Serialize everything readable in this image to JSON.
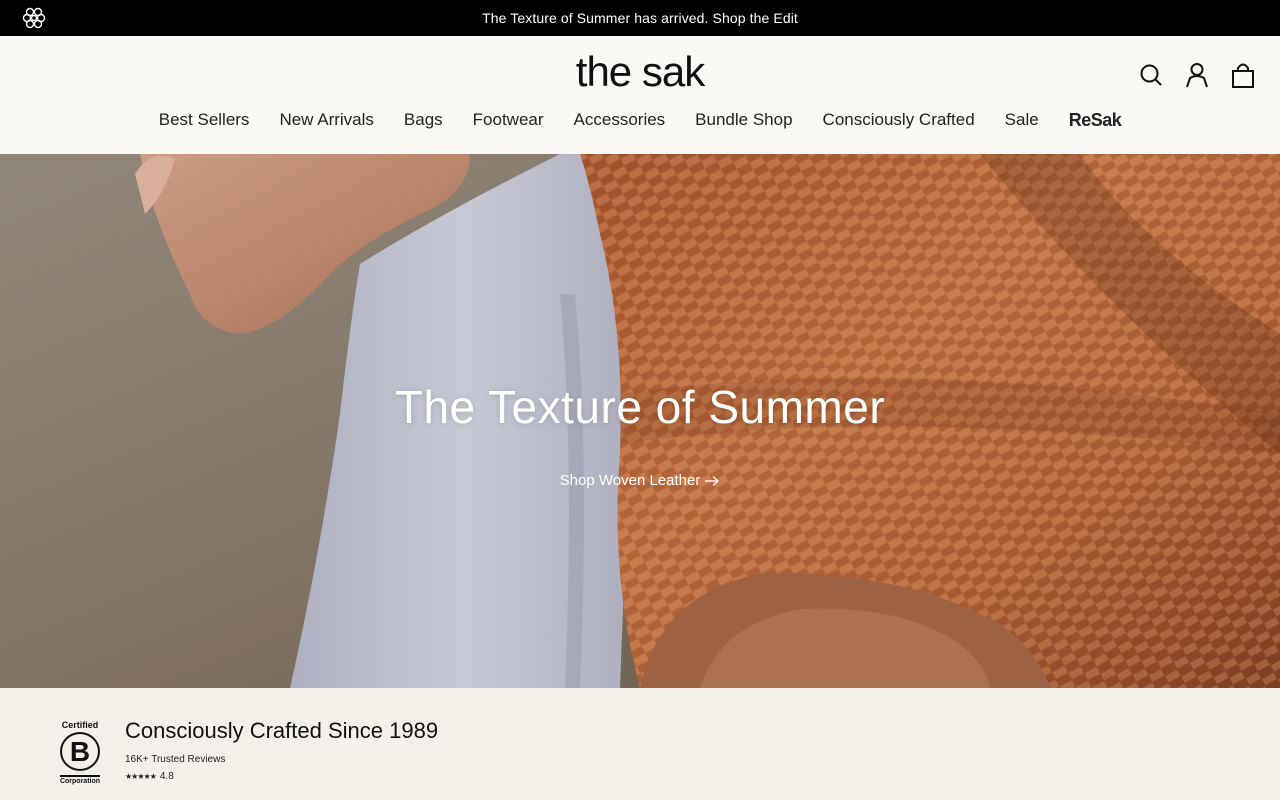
{
  "announcement": {
    "text": "The Texture of Summer has arrived. Shop the Edit"
  },
  "header": {
    "logo": "the sak",
    "nav": [
      {
        "label": "Best Sellers"
      },
      {
        "label": "New Arrivals"
      },
      {
        "label": "Bags"
      },
      {
        "label": "Footwear"
      },
      {
        "label": "Accessories"
      },
      {
        "label": "Bundle Shop"
      },
      {
        "label": "Consciously Crafted"
      },
      {
        "label": "Sale"
      },
      {
        "label": "ReSak"
      }
    ],
    "icons": [
      "search-icon",
      "account-icon",
      "bag-icon"
    ]
  },
  "hero": {
    "title": "The Texture of Summer",
    "cta": "Shop Woven Leather"
  },
  "bottom": {
    "badge_top": "Certified",
    "badge_letter": "B",
    "badge_bottom": "Corporation",
    "title": "Consciously Crafted Since 1989",
    "reviews": "16K+ Trusted Reviews",
    "stars": "★★★★★",
    "rating": "4.8"
  },
  "colors": {
    "announcement_bg": "#000000",
    "header_bg": "#faf9f6",
    "bottom_bg": "#f3f0ea",
    "hero_accent": "#c4683a"
  }
}
